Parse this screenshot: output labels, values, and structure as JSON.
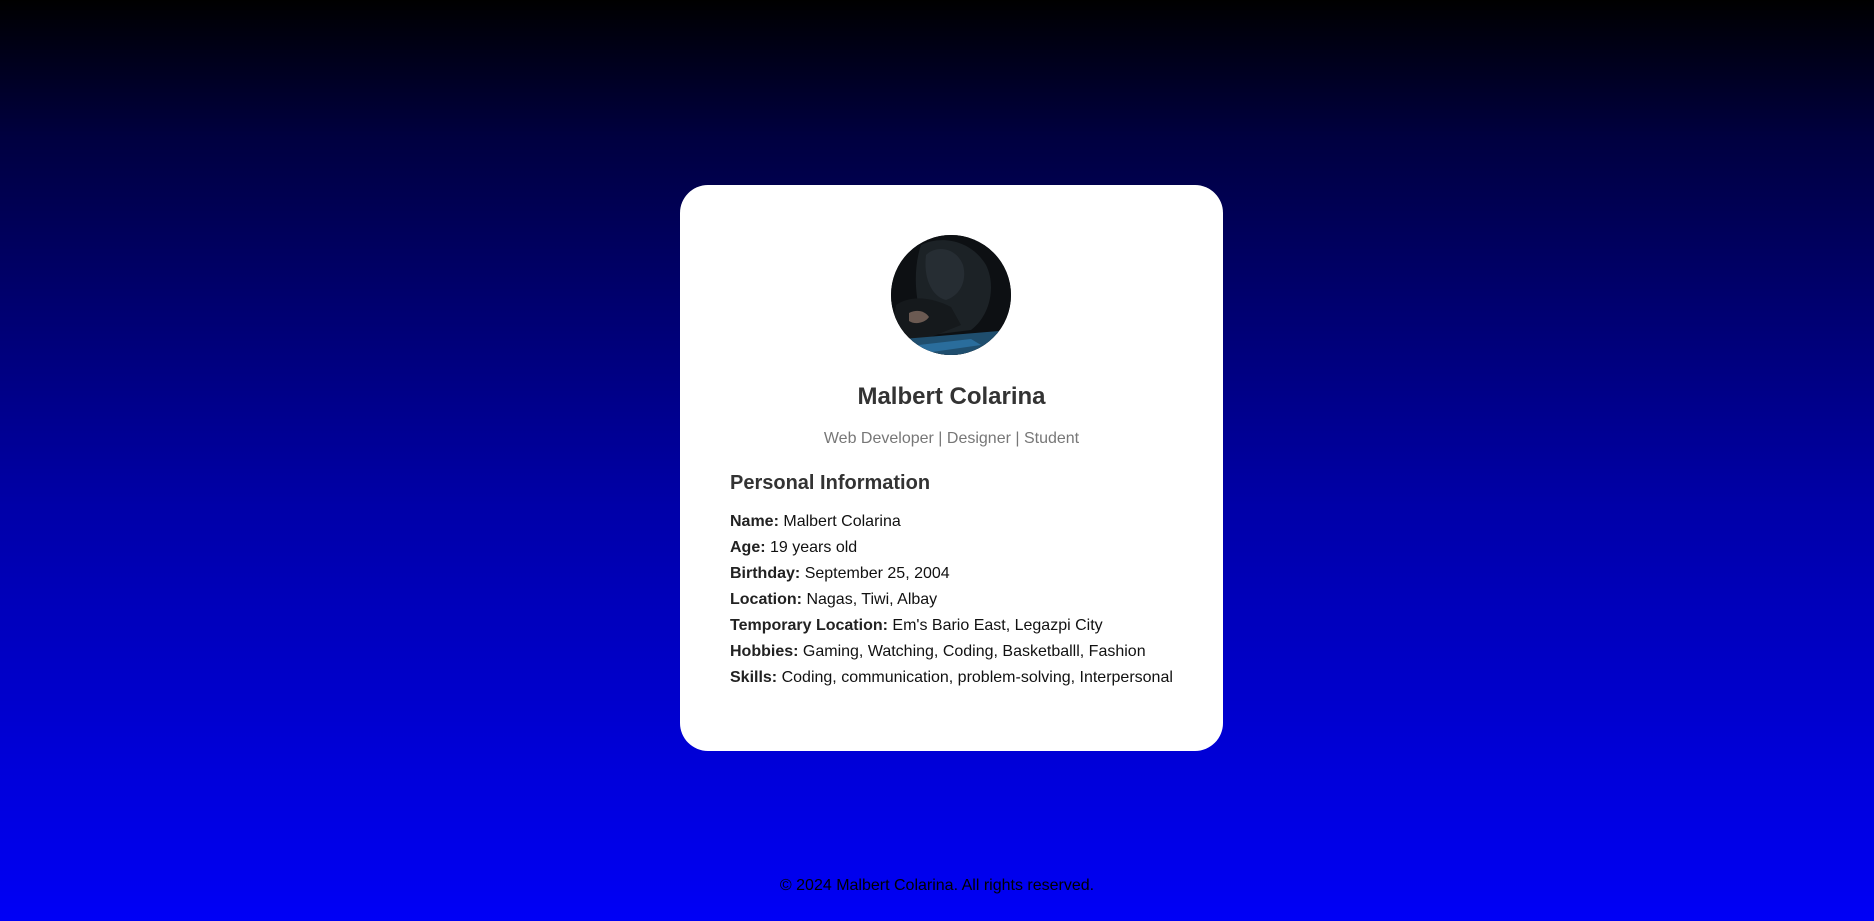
{
  "profile": {
    "name": "Malbert Colarina",
    "tagline": "Web Developer | Designer | Student",
    "avatar": "profile-photo"
  },
  "personal_info": {
    "title": "Personal Information",
    "items": [
      {
        "label": "Name:",
        "value": "Malbert Colarina"
      },
      {
        "label": "Age:",
        "value": "19 years old"
      },
      {
        "label": "Birthday:",
        "value": "September 25, 2004"
      },
      {
        "label": "Location:",
        "value": "Nagas, Tiwi, Albay"
      },
      {
        "label": "Temporary Location:",
        "value": "Em's Bario East, Legazpi City"
      },
      {
        "label": "Hobbies:",
        "value": "Gaming, Watching, Coding, Basketballl, Fashion"
      },
      {
        "label": "Skills:",
        "value": "Coding, communication, problem-solving, Interpersonal"
      }
    ]
  },
  "footer": {
    "text": "© 2024 Malbert Colarina. All rights reserved."
  },
  "colors": {
    "background_top": "#000000",
    "background_bottom": "#0000f6",
    "card": "#ffffff"
  }
}
